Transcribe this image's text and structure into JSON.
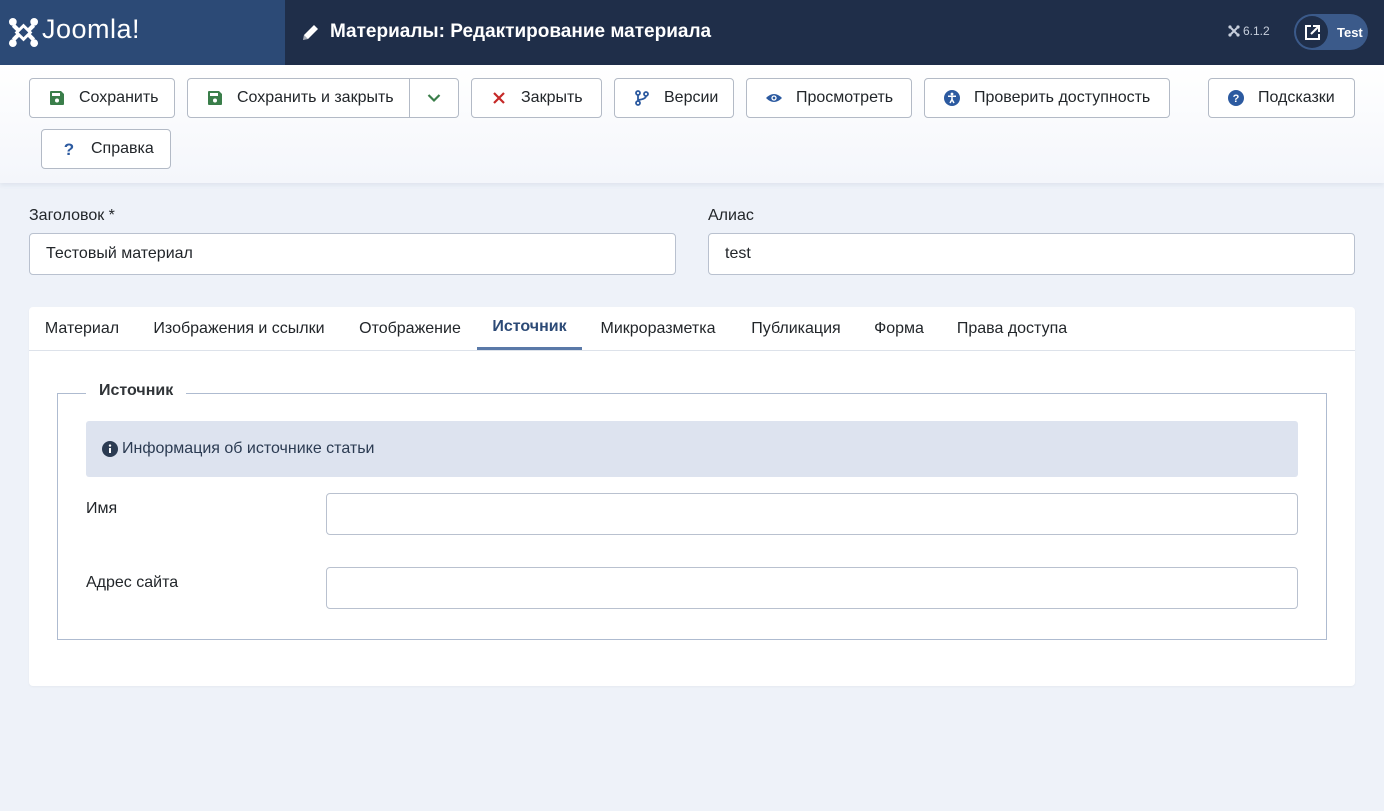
{
  "header": {
    "logo_text": "Joomla!",
    "page_title": "Материалы: Редактирование материала",
    "version": "6.1.2",
    "user_label": "Test",
    "colors": {
      "header_bg": "#1f2e49",
      "logo_bg": "#2c4a76",
      "pill_bg": "#3b5a8a"
    }
  },
  "toolbar": {
    "save": "Сохранить",
    "save_close": "Сохранить и закрыть",
    "close": "Закрыть",
    "versions": "Версии",
    "preview": "Просмотреть",
    "accessibility": "Проверить доступность",
    "tips": "Подсказки",
    "help": "Справка",
    "icons": {
      "save": "floppy-disk-icon",
      "dropdown": "chevron-down-icon",
      "close": "close-icon",
      "versions": "code-branch-icon",
      "preview": "eye-icon",
      "accessibility": "universal-access-icon",
      "tips": "question-circle-icon",
      "help": "question-icon"
    },
    "colors": {
      "save_icon": "#3a7e4a",
      "close_icon": "#c52827",
      "blue_icon": "#2c5aa0"
    }
  },
  "form": {
    "title_label": "Заголовок *",
    "title_value": "Тестовый материал",
    "alias_label": "Алиас",
    "alias_value": "test"
  },
  "tabs": [
    {
      "label": "Материал",
      "active": false
    },
    {
      "label": "Изображения и ссылки",
      "active": false
    },
    {
      "label": "Отображение",
      "active": false
    },
    {
      "label": "Источник",
      "active": true
    },
    {
      "label": "Микроразметка",
      "active": false
    },
    {
      "label": "Публикация",
      "active": false
    },
    {
      "label": "Форма",
      "active": false
    },
    {
      "label": "Права доступа",
      "active": false
    }
  ],
  "source": {
    "legend": "Источник",
    "info": "Информация об источнике статьи",
    "name_label": "Имя",
    "name_value": "",
    "url_label": "Адрес сайта",
    "url_value": ""
  }
}
